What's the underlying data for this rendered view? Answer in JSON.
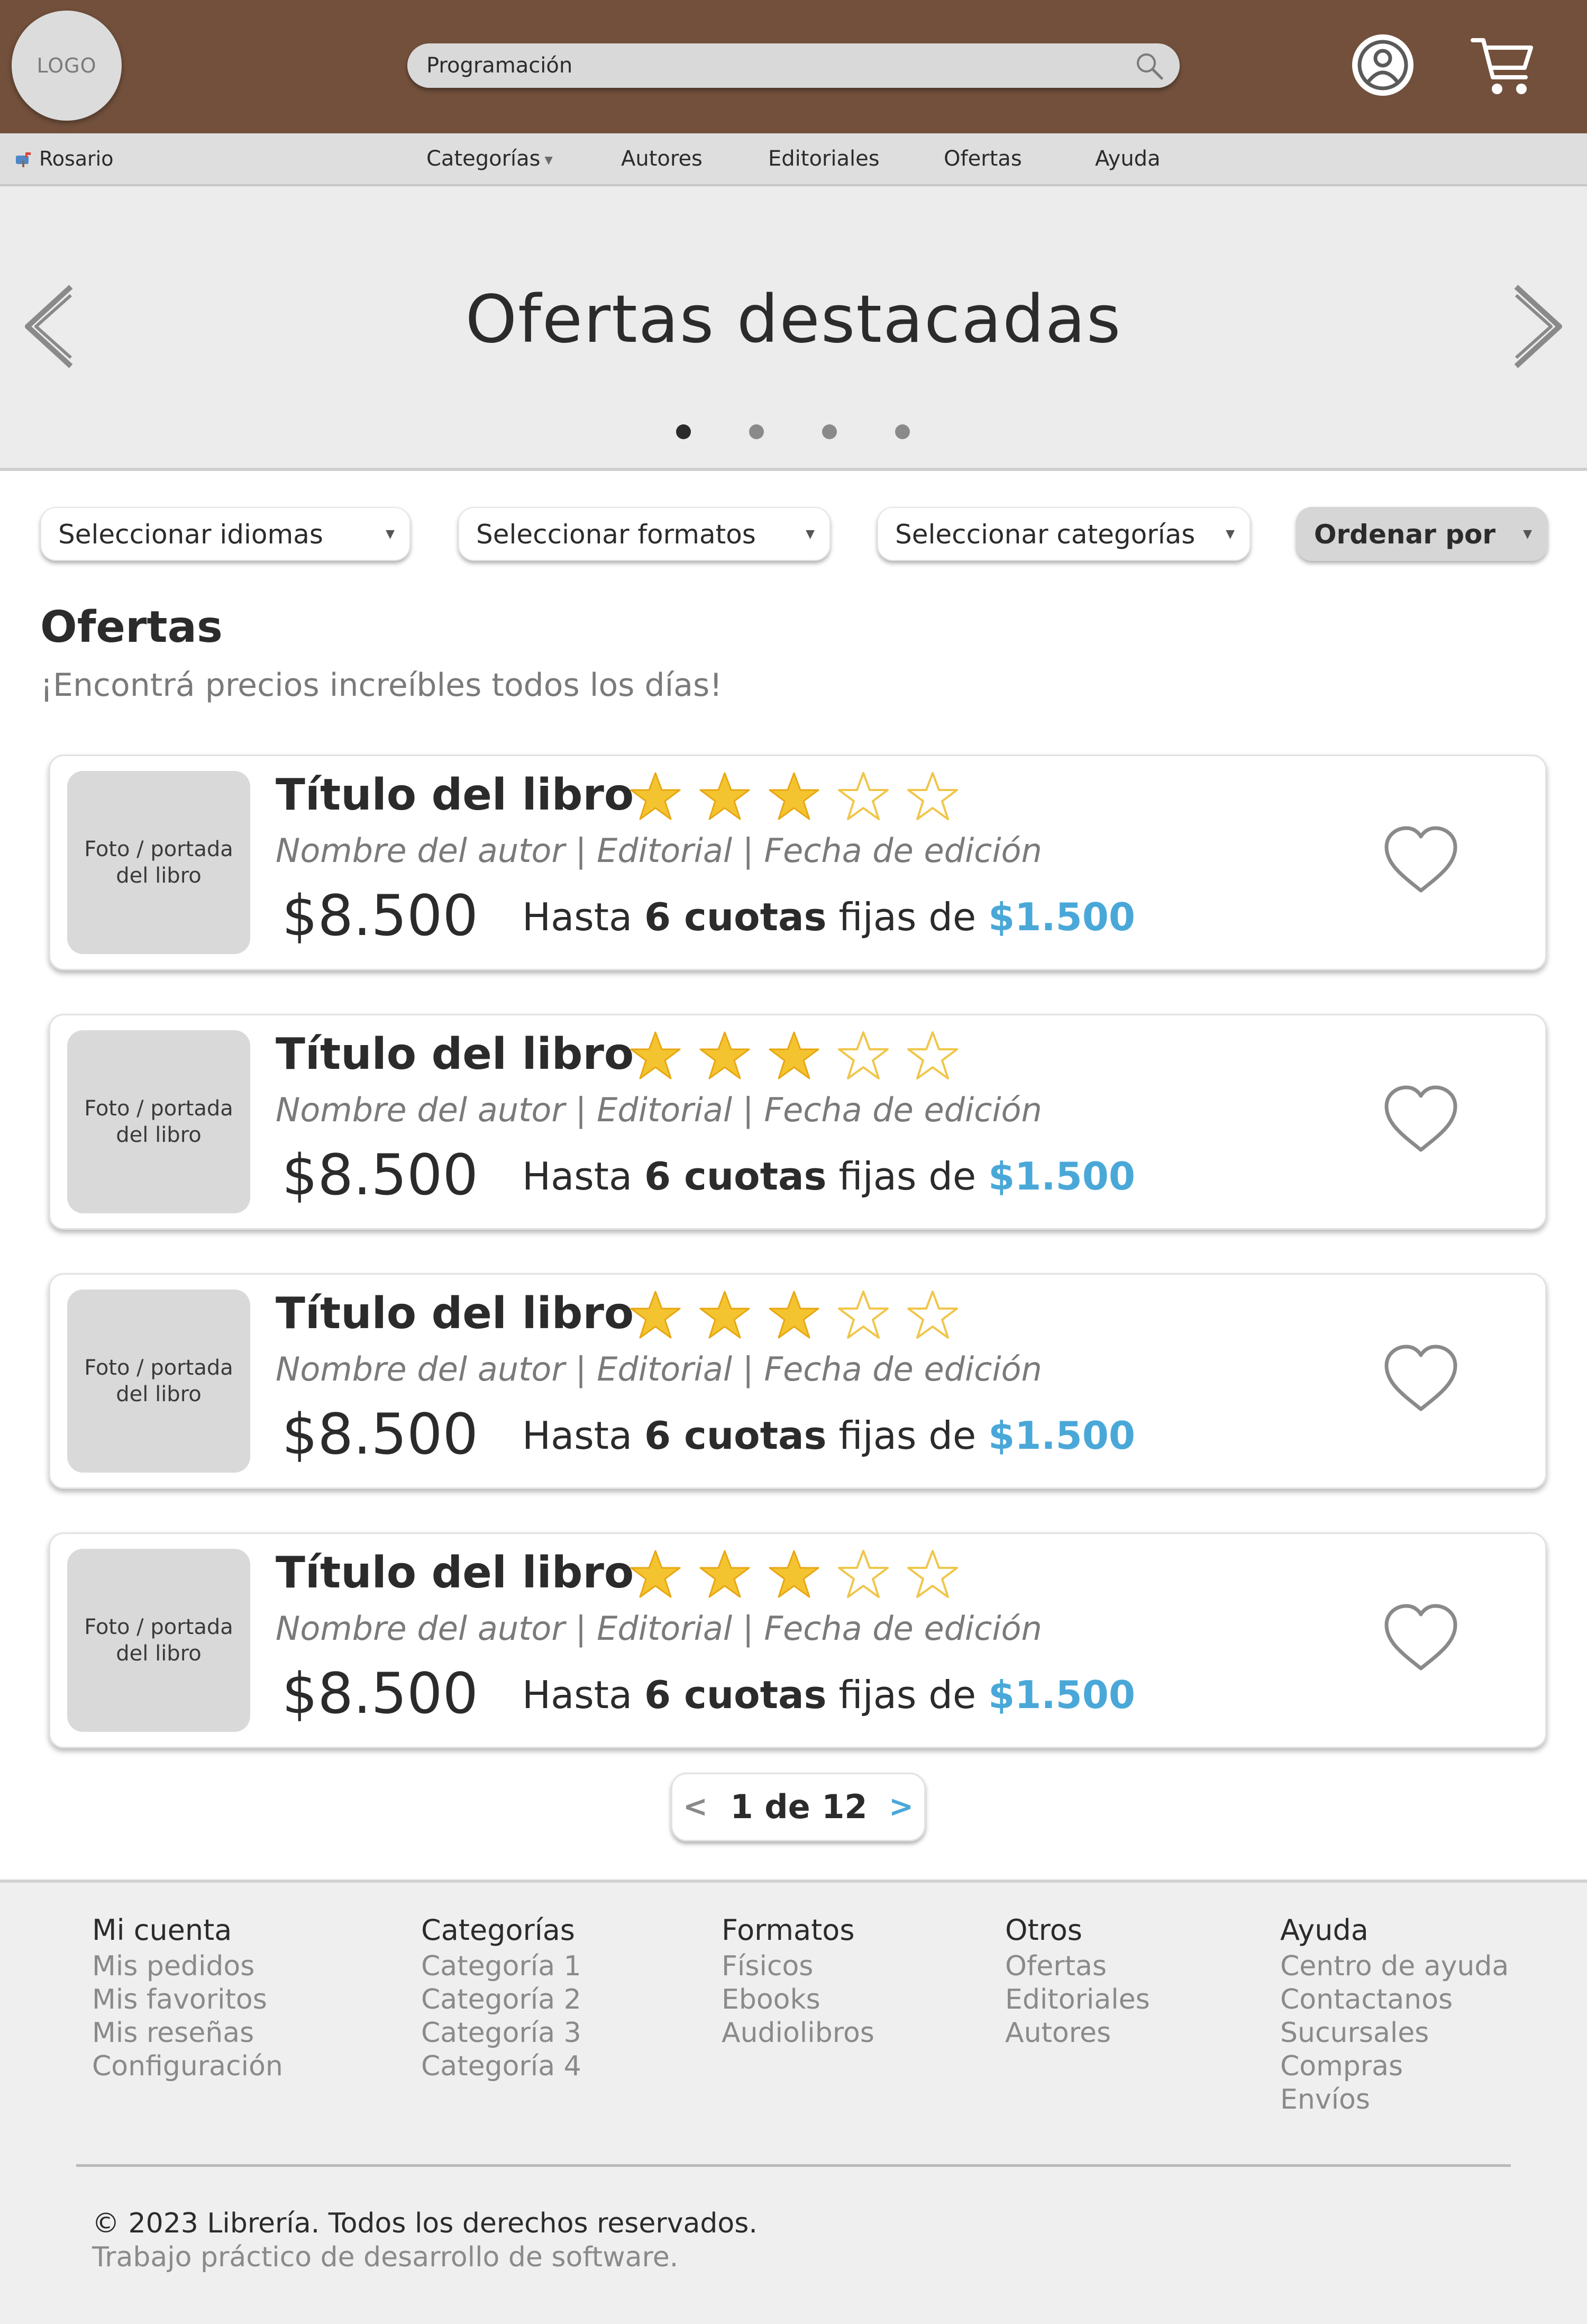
{
  "header": {
    "logo_text": "LOGO",
    "search_value": "Programación",
    "search_icon": "magnifier-icon",
    "user_icon": "user-account-icon",
    "cart_icon": "shopping-cart-icon",
    "bg_color": "#72503c"
  },
  "navbar": {
    "location": "Rosario",
    "location_icon": "mailbox-icon",
    "items": [
      {
        "label": "Categorías",
        "has_dropdown": true
      },
      {
        "label": "Autores"
      },
      {
        "label": "Editoriales"
      },
      {
        "label": "Ofertas"
      },
      {
        "label": "Ayuda"
      }
    ]
  },
  "hero": {
    "title": "Ofertas destacadas",
    "slide_count": 4,
    "active_slide": 1
  },
  "filters": [
    {
      "label": "Seleccionar idiomas"
    },
    {
      "label": "Seleccionar formatos"
    },
    {
      "label": "Seleccionar categorías"
    },
    {
      "label": "Ordenar por"
    }
  ],
  "section": {
    "title": "Ofertas",
    "subtitle": "¡Encontrá precios increíbles todos los días!"
  },
  "books": [
    {
      "cover": "Foto / portada del libro",
      "title": "Título del libro",
      "rating": 3,
      "max_rating": 5,
      "meta": "Nombre del autor | Editorial | Fecha de edición",
      "price": "$8.500",
      "inst_prefix": "Hasta ",
      "inst_count": "6 cuotas",
      "inst_mid": " fijas de ",
      "inst_amount": "$1.500"
    },
    {
      "cover": "Foto / portada del libro",
      "title": "Título del libro",
      "rating": 3,
      "max_rating": 5,
      "meta": "Nombre del autor | Editorial | Fecha de edición",
      "price": "$8.500",
      "inst_prefix": "Hasta ",
      "inst_count": "6 cuotas",
      "inst_mid": " fijas de ",
      "inst_amount": "$1.500"
    },
    {
      "cover": "Foto / portada del libro",
      "title": "Título del libro",
      "rating": 3,
      "max_rating": 5,
      "meta": "Nombre del autor | Editorial | Fecha de edición",
      "price": "$8.500",
      "inst_prefix": "Hasta ",
      "inst_count": "6 cuotas",
      "inst_mid": " fijas de ",
      "inst_amount": "$1.500"
    },
    {
      "cover": "Foto / portada del libro",
      "title": "Título del libro",
      "rating": 3,
      "max_rating": 5,
      "meta": "Nombre del autor | Editorial | Fecha de edición",
      "price": "$8.500",
      "inst_prefix": "Hasta ",
      "inst_count": "6 cuotas",
      "inst_mid": " fijas de ",
      "inst_amount": "$1.500"
    }
  ],
  "pagination": {
    "prev": "<",
    "text": "1 de 12",
    "next": ">"
  },
  "footer": {
    "columns": [
      {
        "heading": "Mi cuenta",
        "links": [
          "Mis pedidos",
          "Mis favoritos",
          "Mis reseñas",
          "Configuración"
        ]
      },
      {
        "heading": "Categorías",
        "links": [
          "Categoría 1",
          "Categoría 2",
          "Categoría 3",
          "Categoría 4"
        ]
      },
      {
        "heading": "Formatos",
        "links": [
          "Físicos",
          "Ebooks",
          "Audiolibros"
        ]
      },
      {
        "heading": "Otros",
        "links": [
          "Ofertas",
          "Editoriales",
          "Autores"
        ]
      },
      {
        "heading": "Ayuda",
        "links": [
          "Centro de ayuda",
          "Contactanos",
          "Sucursales",
          "Compras",
          "Envíos"
        ]
      }
    ],
    "copyright": "© 2023 Librería. Todos los derechos reservados.",
    "note": "Trabajo práctico de desarrollo de software."
  },
  "colors": {
    "accent_blue": "#4aa8d8",
    "star_gold": "#f2c23a",
    "header_brown": "#72503c"
  }
}
